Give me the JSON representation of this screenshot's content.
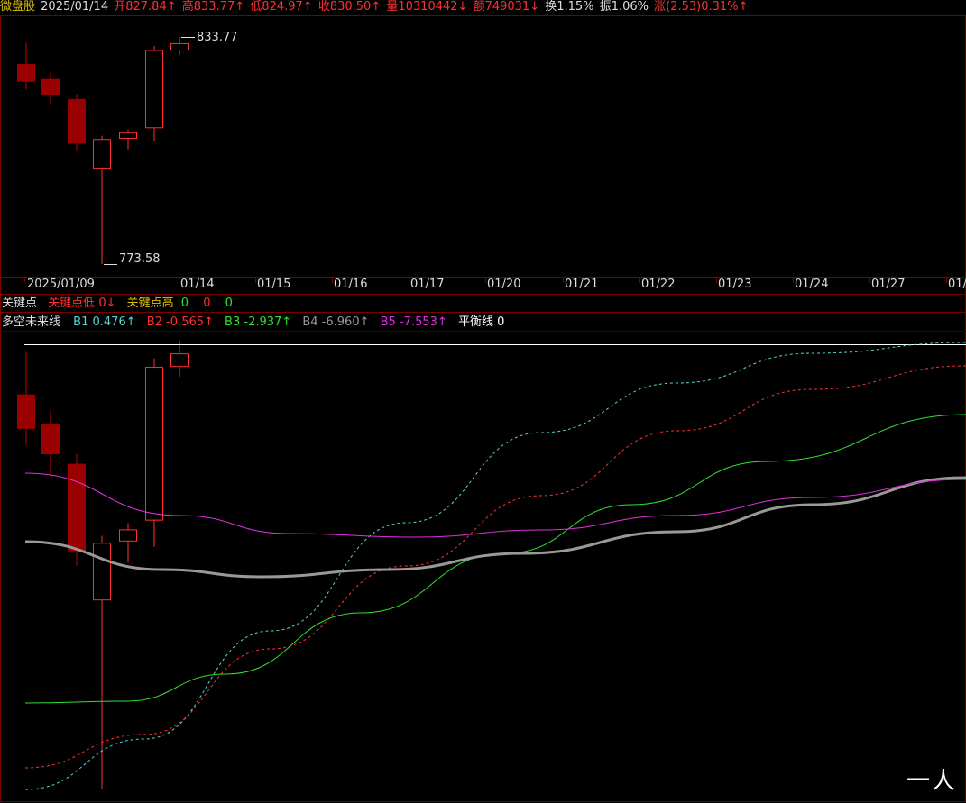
{
  "header": {
    "stock_name": "微盘股",
    "date": "2025/01/14",
    "open": "开827.84↑",
    "high": "高833.77↑",
    "low": "低824.97↑",
    "close": "收830.50↑",
    "volume": "量10310442↓",
    "amount": "额749031↓",
    "turnover": "换1.15%",
    "amplitude": "振1.06%",
    "change": "涨(2.53)0.31%↑"
  },
  "price_pane": {
    "high_label": "833.77",
    "low_label": "773.58",
    "candles": [
      {
        "o": 826.5,
        "h": 832.3,
        "l": 819.8,
        "c": 822.0
      },
      {
        "o": 822.5,
        "h": 824.4,
        "l": 815.7,
        "c": 818.6
      },
      {
        "o": 817.2,
        "h": 818.6,
        "l": 803.6,
        "c": 805.6
      },
      {
        "o": 799.0,
        "h": 807.6,
        "l": 773.58,
        "c": 806.6
      },
      {
        "o": 806.9,
        "h": 809.3,
        "l": 804.0,
        "c": 808.4
      },
      {
        "o": 809.7,
        "h": 831.4,
        "l": 806.1,
        "c": 830.2
      },
      {
        "o": 830.3,
        "h": 833.77,
        "l": 828.9,
        "c": 832.0
      }
    ]
  },
  "date_axis": {
    "ticks": [
      "2025/01/09",
      "01/14",
      "01/15",
      "01/16",
      "01/17",
      "01/20",
      "01/21",
      "01/22",
      "01/23",
      "01/24",
      "01/27",
      "01/"
    ]
  },
  "indicator1": {
    "name": "关键点",
    "low_label": "关键点低",
    "low_value": "0↓",
    "high_label": "关键点高",
    "high_value": "0",
    "val2": "0",
    "val3": "0"
  },
  "indicator2": {
    "name": "多空未来线",
    "b1": {
      "label": "B1",
      "value": "0.476↑"
    },
    "b2": {
      "label": "B2",
      "value": "-0.565↑"
    },
    "b3": {
      "label": "B3",
      "value": "-2.937↑"
    },
    "b4": {
      "label": "B4",
      "value": "-6.960↑"
    },
    "b5": {
      "label": "B5",
      "value": "-7.553↑"
    },
    "balance": {
      "label": "平衡线",
      "value": "0"
    }
  },
  "watermark": "一人",
  "colors": {
    "up": "#ff3030",
    "down": "#9a0000",
    "grid": "#7a0000",
    "b1": "#5ad4d4",
    "b2": "#ff3030",
    "b3": "#30e030",
    "b4": "#999999",
    "b5": "#e030e0",
    "balance": "#ffffff"
  }
}
